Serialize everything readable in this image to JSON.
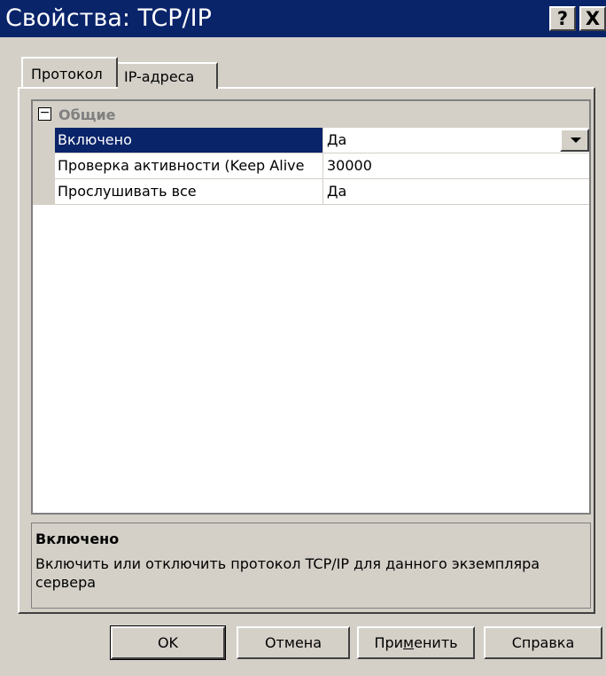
{
  "window": {
    "title": "Свойства: TCP/IP",
    "help_button": "?",
    "close_button": "X"
  },
  "tabs": [
    {
      "label": "Протокол",
      "active": true
    },
    {
      "label": "IP-адреса",
      "active": false
    }
  ],
  "grid": {
    "category": {
      "label": "Общие",
      "toggle": "−",
      "expanded": true
    },
    "properties": [
      {
        "name": "Включено",
        "value": "Да",
        "selected": true,
        "has_dropdown": true
      },
      {
        "name": "Проверка активности (Keep Alive",
        "value": "30000",
        "selected": false
      },
      {
        "name": "Прослушивать все",
        "value": "Да",
        "selected": false
      }
    ]
  },
  "description": {
    "title": "Включено",
    "text": "Включить или отключить протокол TCP/IP для данного экземпляра сервера"
  },
  "buttons": {
    "ok": "OK",
    "cancel": "Отмена",
    "apply_pre": "При",
    "apply_mnemonic": "м",
    "apply_post": "енить",
    "help": "Справка"
  },
  "colors": {
    "titlebar": "#0a246a",
    "face": "#d4d0c8",
    "selection": "#0a246a"
  }
}
